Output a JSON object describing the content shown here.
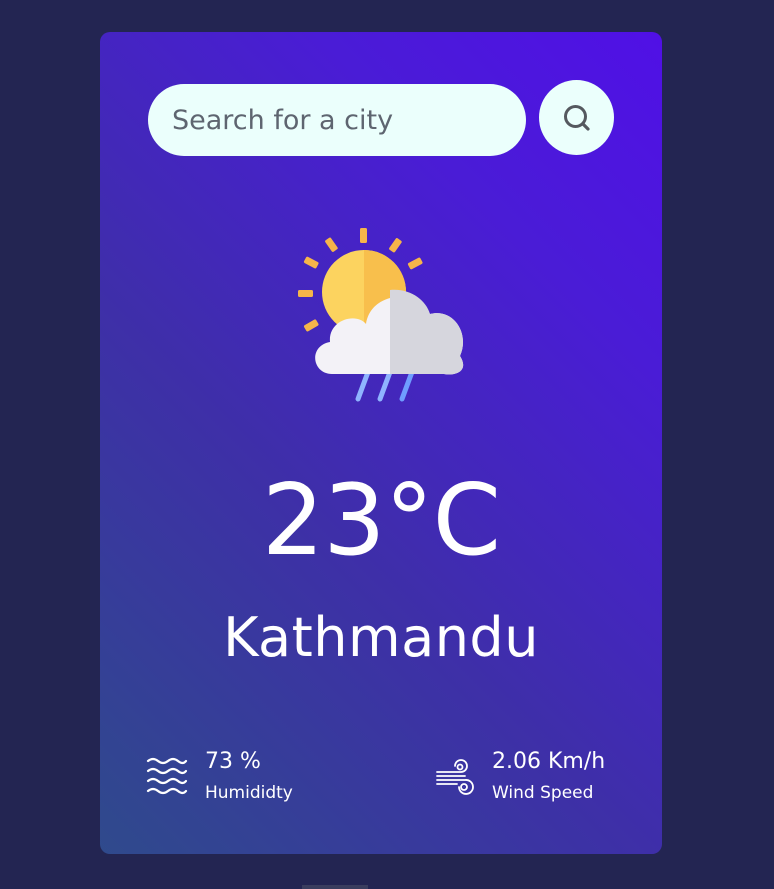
{
  "search": {
    "placeholder": "Search for a city",
    "value": "",
    "button_icon": "search-icon"
  },
  "weather": {
    "icon": "sun-cloud-rain-icon",
    "temperature": "23°C",
    "city": "Kathmandu"
  },
  "details": {
    "humidity": {
      "icon": "humidity-waves-icon",
      "value": "73 %",
      "label": "Humididty"
    },
    "wind": {
      "icon": "wind-icon",
      "value": "2.06 Km/h",
      "label": "Wind Speed"
    }
  },
  "colors": {
    "page_background": "#232552",
    "card_gradient_start": "#2f4a8c",
    "card_gradient_end": "#5010e6",
    "input_background": "#ebfffc",
    "text": "#ffffff"
  }
}
